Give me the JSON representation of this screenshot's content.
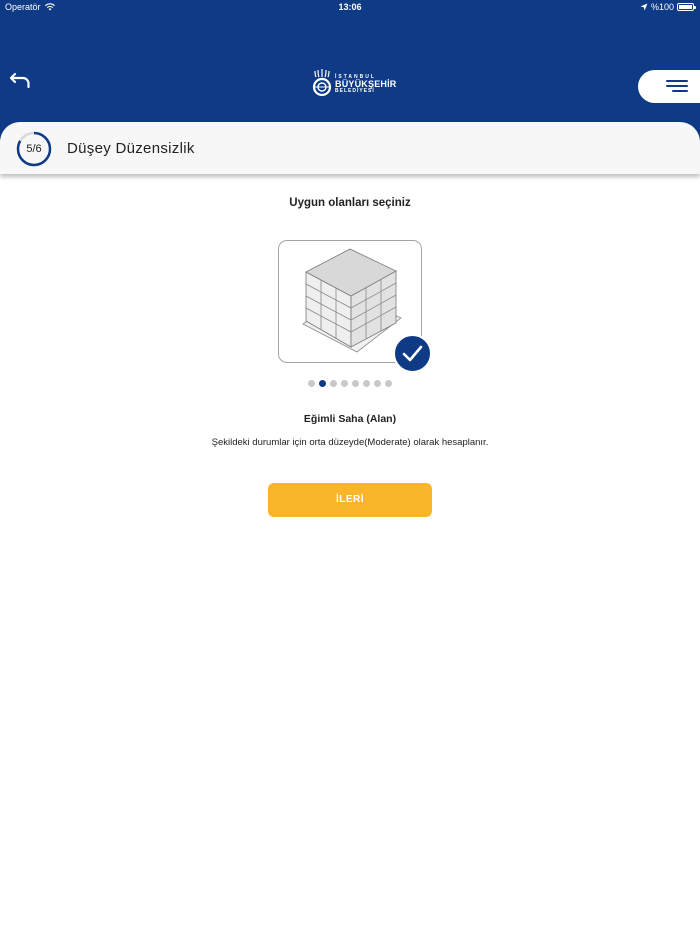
{
  "status_bar": {
    "carrier": "Operatör",
    "time": "13:06",
    "battery_text": "%100",
    "battery_level": 1.0,
    "icons": [
      "wifi-icon",
      "location-arrow-icon",
      "battery-icon"
    ]
  },
  "header": {
    "logo": {
      "line1": "İSTANBUL",
      "line2": "BÜYÜKŞEHİR",
      "line3": "BELEDİYESİ"
    },
    "back_icon": "back-arrow-icon",
    "menu_icon": "hamburger-menu-icon"
  },
  "step": {
    "label": "5/6",
    "current": 5,
    "total": 6,
    "title": "Düşey Düzensizlik"
  },
  "question": "Uygun olanları seçiniz",
  "carousel": {
    "total": 8,
    "active_index": 1,
    "selected": true
  },
  "option": {
    "title": "Eğimli Saha (Alan)",
    "description": "Şekildeki durumlar için orta düzeyde(Moderate) olarak hesaplanır."
  },
  "next_button_label": "İLERİ",
  "colors": {
    "primary": "#0e3a86",
    "accent": "#fbb52b",
    "dot_inactive": "#c8c8c8"
  }
}
